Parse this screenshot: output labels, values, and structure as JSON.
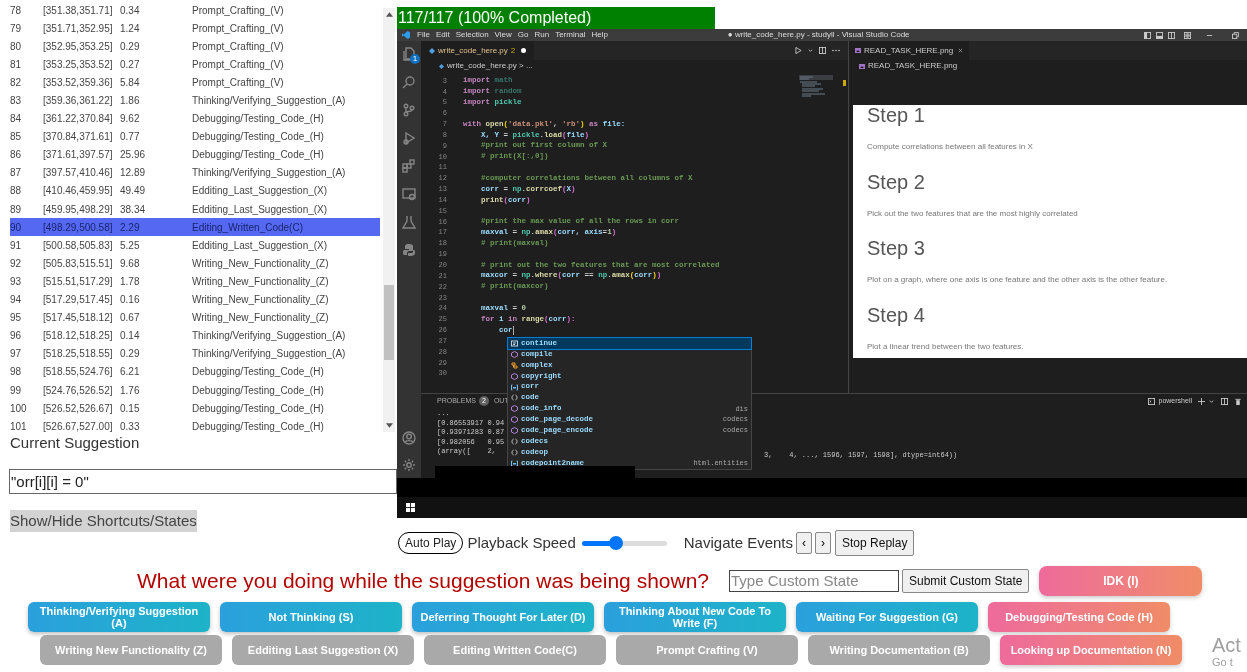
{
  "events_table": {
    "rows": [
      {
        "index": "78",
        "interval": "[351.38,351.71]",
        "duration": "0.34",
        "state": "Prompt_Crafting_(V)",
        "selected": false
      },
      {
        "index": "79",
        "interval": "[351.71,352.95]",
        "duration": "1.24",
        "state": "Prompt_Crafting_(V)",
        "selected": false
      },
      {
        "index": "80",
        "interval": "[352.95,353.25]",
        "duration": "0.29",
        "state": "Prompt_Crafting_(V)",
        "selected": false
      },
      {
        "index": "81",
        "interval": "[353.25,353.52]",
        "duration": "0.27",
        "state": "Prompt_Crafting_(V)",
        "selected": false
      },
      {
        "index": "82",
        "interval": "[353.52,359.36]",
        "duration": "5.84",
        "state": "Prompt_Crafting_(V)",
        "selected": false
      },
      {
        "index": "83",
        "interval": "[359.36,361.22]",
        "duration": "1.86",
        "state": "Thinking/Verifying_Suggestion_(A)",
        "selected": false
      },
      {
        "index": "84",
        "interval": "[361.22,370.84]",
        "duration": "9.62",
        "state": "Debugging/Testing_Code_(H)",
        "selected": false
      },
      {
        "index": "85",
        "interval": "[370.84,371.61]",
        "duration": "0.77",
        "state": "Debugging/Testing_Code_(H)",
        "selected": false
      },
      {
        "index": "86",
        "interval": "[371.61,397.57]",
        "duration": "25.96",
        "state": "Debugging/Testing_Code_(H)",
        "selected": false
      },
      {
        "index": "87",
        "interval": "[397.57,410.46]",
        "duration": "12.89",
        "state": "Thinking/Verifying_Suggestion_(A)",
        "selected": false
      },
      {
        "index": "88",
        "interval": "[410.46,459.95]",
        "duration": "49.49",
        "state": "Edditing_Last_Suggestion_(X)",
        "selected": false
      },
      {
        "index": "89",
        "interval": "[459.95,498.29]",
        "duration": "38.34",
        "state": "Edditing_Last_Suggestion_(X)",
        "selected": false
      },
      {
        "index": "90",
        "interval": "[498.29,500.58]",
        "duration": "2.29",
        "state": "Editing_Written_Code(C)",
        "selected": true
      },
      {
        "index": "91",
        "interval": "[500.58,505.83]",
        "duration": "5.25",
        "state": "Edditing_Last_Suggestion_(X)",
        "selected": false
      },
      {
        "index": "92",
        "interval": "[505.83,515.51]",
        "duration": "9.68",
        "state": "Writing_New_Functionality_(Z)",
        "selected": false
      },
      {
        "index": "93",
        "interval": "[515.51,517.29]",
        "duration": "1.78",
        "state": "Writing_New_Functionality_(Z)",
        "selected": false
      },
      {
        "index": "94",
        "interval": "[517.29,517.45]",
        "duration": "0.16",
        "state": "Writing_New_Functionality_(Z)",
        "selected": false
      },
      {
        "index": "95",
        "interval": "[517.45,518.12]",
        "duration": "0.67",
        "state": "Writing_New_Functionality_(Z)",
        "selected": false
      },
      {
        "index": "96",
        "interval": "[518.12,518.25]",
        "duration": "0.14",
        "state": "Thinking/Verifying_Suggestion_(A)",
        "selected": false
      },
      {
        "index": "97",
        "interval": "[518.25,518.55]",
        "duration": "0.29",
        "state": "Thinking/Verifying_Suggestion_(A)",
        "selected": false
      },
      {
        "index": "98",
        "interval": "[518.55,524.76]",
        "duration": "6.21",
        "state": "Debugging/Testing_Code_(H)",
        "selected": false
      },
      {
        "index": "99",
        "interval": "[524.76,526.52]",
        "duration": "1.76",
        "state": "Debugging/Testing_Code_(H)",
        "selected": false
      },
      {
        "index": "100",
        "interval": "[526.52,526.67]",
        "duration": "0.15",
        "state": "Debugging/Testing_Code_(H)",
        "selected": false
      },
      {
        "index": "101",
        "interval": "[526.67,527.00]",
        "duration": "0.33",
        "state": "Debugging/Testing_Code_(H)",
        "selected": false
      }
    ]
  },
  "current_suggestion": {
    "label": "Current Suggestion",
    "value": "\"orr[i][i] = 0\""
  },
  "toggle_button": "Show/Hide Shortcuts/States",
  "progress": {
    "label": "117/117 (100% Completed)"
  },
  "vscode": {
    "menu": [
      "File",
      "Edit",
      "Selection",
      "View",
      "Go",
      "Run",
      "Terminal",
      "Help"
    ],
    "window_title": "● write_code_here.py - studyll - Visual Studio Code",
    "explorer_badge": "1",
    "editor_tab": {
      "name": "write_code_here.py",
      "count": "2",
      "modified": true
    },
    "breadcrumb": "write_code_here.py > ...",
    "code_lines": [
      {
        "number": "3",
        "tokens": [
          {
            "text": "import",
            "kind": "kw"
          },
          {
            "text": " math",
            "kind": "dim"
          }
        ]
      },
      {
        "number": "4",
        "tokens": [
          {
            "text": "import",
            "kind": "kw"
          },
          {
            "text": " random",
            "kind": "dim"
          }
        ]
      },
      {
        "number": "5",
        "tokens": [
          {
            "text": "import",
            "kind": "kw"
          },
          {
            "text": " pickle",
            "kind": "mod"
          }
        ]
      },
      {
        "number": "6"
      },
      {
        "number": "7",
        "tokens": [
          {
            "text": "with",
            "kind": "kw"
          },
          {
            "text": " open",
            "kind": "fn"
          },
          {
            "text": "(",
            "kind": "br"
          },
          {
            "text": "'data.pkl'",
            "kind": "str"
          },
          {
            "text": ", ",
            "kind": "pl"
          },
          {
            "text": "'rb'",
            "kind": "str"
          },
          {
            "text": ")",
            "kind": "br"
          },
          {
            "text": " as",
            "kind": "kw"
          },
          {
            "text": " file:",
            "kind": "var"
          }
        ]
      },
      {
        "number": "8",
        "tokens": [
          {
            "text": "    X, Y",
            "kind": "var"
          },
          {
            "text": " = ",
            "kind": "pl"
          },
          {
            "text": "pickle",
            "kind": "mod"
          },
          {
            "text": ".",
            "kind": "pl"
          },
          {
            "text": "load",
            "kind": "fn"
          },
          {
            "text": "(",
            "kind": "br2"
          },
          {
            "text": "file",
            "kind": "var"
          },
          {
            "text": ")",
            "kind": "br2"
          }
        ]
      },
      {
        "number": "9",
        "tokens": [
          {
            "text": "    #print out first column of X",
            "kind": "cmt"
          }
        ]
      },
      {
        "number": "10",
        "tokens": [
          {
            "text": "    # print(X[:,0])",
            "kind": "cmt"
          }
        ]
      },
      {
        "number": "11"
      },
      {
        "number": "12",
        "tokens": [
          {
            "text": "    #computer correlations between all columns of X",
            "kind": "cmt"
          }
        ]
      },
      {
        "number": "13",
        "tokens": [
          {
            "text": "    corr",
            "kind": "var"
          },
          {
            "text": " = ",
            "kind": "pl"
          },
          {
            "text": "np",
            "kind": "mod"
          },
          {
            "text": ".",
            "kind": "pl"
          },
          {
            "text": "corrcoef",
            "kind": "fn"
          },
          {
            "text": "(",
            "kind": "br2"
          },
          {
            "text": "X",
            "kind": "var"
          },
          {
            "text": ")",
            "kind": "br2"
          }
        ]
      },
      {
        "number": "14",
        "tokens": [
          {
            "text": "    print",
            "kind": "fn"
          },
          {
            "text": "(",
            "kind": "br2"
          },
          {
            "text": "corr",
            "kind": "var"
          },
          {
            "text": ")",
            "kind": "br2"
          }
        ]
      },
      {
        "number": "15"
      },
      {
        "number": "16",
        "tokens": [
          {
            "text": "    #print the max value of all the rows in corr",
            "kind": "cmt"
          }
        ]
      },
      {
        "number": "17",
        "tokens": [
          {
            "text": "    maxval",
            "kind": "var"
          },
          {
            "text": " = ",
            "kind": "pl"
          },
          {
            "text": "np",
            "kind": "mod"
          },
          {
            "text": ".",
            "kind": "pl"
          },
          {
            "text": "amax",
            "kind": "fn"
          },
          {
            "text": "(",
            "kind": "br2"
          },
          {
            "text": "corr, axis",
            "kind": "var"
          },
          {
            "text": "=",
            "kind": "pl"
          },
          {
            "text": "1",
            "kind": "num"
          },
          {
            "text": ")",
            "kind": "br2"
          }
        ]
      },
      {
        "number": "18",
        "tokens": [
          {
            "text": "    # print(maxval)",
            "kind": "cmt"
          }
        ]
      },
      {
        "number": "19"
      },
      {
        "number": "20",
        "tokens": [
          {
            "text": "    # print out the two features that are most correlated",
            "kind": "cmt"
          }
        ]
      },
      {
        "number": "21",
        "tokens": [
          {
            "text": "    maxcor",
            "kind": "var"
          },
          {
            "text": " = ",
            "kind": "pl"
          },
          {
            "text": "np",
            "kind": "mod"
          },
          {
            "text": ".",
            "kind": "pl"
          },
          {
            "text": "where",
            "kind": "fn"
          },
          {
            "text": "(",
            "kind": "br2"
          },
          {
            "text": "corr",
            "kind": "var"
          },
          {
            "text": " == ",
            "kind": "pl"
          },
          {
            "text": "np",
            "kind": "mod"
          },
          {
            "text": ".",
            "kind": "pl"
          },
          {
            "text": "amax",
            "kind": "fn"
          },
          {
            "text": "(",
            "kind": "br"
          },
          {
            "text": "corr",
            "kind": "var"
          },
          {
            "text": ")",
            "kind": "br"
          },
          {
            "text": ")",
            "kind": "br2"
          }
        ]
      },
      {
        "number": "22",
        "tokens": [
          {
            "text": "    # print(maxcor)",
            "kind": "cmt"
          }
        ]
      },
      {
        "number": "23"
      },
      {
        "number": "24",
        "tokens": [
          {
            "text": "    maxval",
            "kind": "var"
          },
          {
            "text": " = ",
            "kind": "pl"
          },
          {
            "text": "0",
            "kind": "num"
          }
        ]
      },
      {
        "number": "25",
        "tokens": [
          {
            "text": "    for",
            "kind": "kw"
          },
          {
            "text": " i",
            "kind": "var"
          },
          {
            "text": " in",
            "kind": "kw"
          },
          {
            "text": " range",
            "kind": "fn"
          },
          {
            "text": "(",
            "kind": "br2"
          },
          {
            "text": "corr",
            "kind": "var"
          },
          {
            "text": "):",
            "kind": "br2"
          }
        ]
      },
      {
        "number": "26",
        "tokens": [
          {
            "text": "        cor",
            "kind": "var"
          }
        ],
        "cursor": true
      },
      {
        "number": "27"
      },
      {
        "number": "28"
      },
      {
        "number": "29"
      },
      {
        "number": "30"
      }
    ],
    "suggestions": [
      {
        "label": "continue",
        "kind": "keyword",
        "selected": true
      },
      {
        "label": "compile",
        "kind": "method",
        "selected": false
      },
      {
        "label": "complex",
        "kind": "class",
        "selected": false
      },
      {
        "label": "copyright",
        "kind": "method",
        "selected": false
      },
      {
        "label": "corr",
        "kind": "variable",
        "selected": false
      },
      {
        "label": "code",
        "kind": "module",
        "selected": false
      },
      {
        "label": "code_info",
        "kind": "method",
        "detail": "dis",
        "selected": false
      },
      {
        "label": "code_page_decode",
        "kind": "method",
        "detail": "codecs",
        "selected": false
      },
      {
        "label": "code_page_encode",
        "kind": "method",
        "detail": "codecs",
        "selected": false
      },
      {
        "label": "codecs",
        "kind": "module",
        "selected": false
      },
      {
        "label": "codeop",
        "kind": "module",
        "selected": false
      },
      {
        "label": "codepoint2name",
        "kind": "variable",
        "detail": "html.entities",
        "selected": false
      }
    ],
    "panel": {
      "tabs": [
        {
          "label": "PROBLEMS",
          "count": "2"
        },
        {
          "label": "OUT"
        }
      ],
      "terminal_lines": [
        "...",
        "[0.86553917 0.94",
        "[0.93971283 0.87",
        "[0.982056   0.95",
        "(array([    2,"
      ],
      "terminal_tail": "3,    4, ..., 1596, 1597, 1598], dtype=int64))",
      "shell": "powershell"
    },
    "image_tab": "READ_TASK_HERE.png",
    "image_breadcrumb": "READ_TASK_HERE.png",
    "steps": [
      {
        "title": "Step 1",
        "text": "Compute correlations between all features in X"
      },
      {
        "title": "Step 2",
        "text": "Pick out the two features that are the most highly correlated"
      },
      {
        "title": "Step 3",
        "text": "Plot on a graph, where one axis is one feature and the other axis is the other feature."
      },
      {
        "title": "Step 4",
        "text": "Plot a linear trend between the two features."
      }
    ]
  },
  "playback": {
    "auto_play": "Auto Play",
    "speed": {
      "label": "Playback Speed",
      "level": 0.4
    },
    "navigate_label": "Navigate Events",
    "previous": "‹",
    "next": "›",
    "stop": "Stop Replay"
  },
  "question": {
    "prompt": "What were you doing while the suggestion was being shown?",
    "custom_state": {
      "placeholder": "Type Custom State"
    },
    "submit": "Submit Custom State",
    "idk": {
      "label": "IDK (I)",
      "kind": "accent"
    }
  },
  "state_button_rows": [
    {
      "buttons": [
        {
          "label": "Thinking/Verifying Suggestion (A)",
          "kind": "primary"
        },
        {
          "label": "Not Thinking (S)",
          "kind": "primary"
        },
        {
          "label": "Deferring Thought For Later (D)",
          "kind": "primary"
        },
        {
          "label": "Thinking About New Code To Write (F)",
          "kind": "primary"
        },
        {
          "label": "Waiting For Suggestion (G)",
          "kind": "primary"
        },
        {
          "label": "Debugging/Testing Code (H)",
          "kind": "accent"
        }
      ]
    },
    {
      "buttons": [
        {
          "label": "Writing New Functionality (Z)",
          "kind": "muted"
        },
        {
          "label": "Edditing Last Suggestion (X)",
          "kind": "muted"
        },
        {
          "label": "Editing Written Code(C)",
          "kind": "muted"
        },
        {
          "label": "Prompt Crafting (V)",
          "kind": "muted"
        },
        {
          "label": "Writing Documentation (B)",
          "kind": "muted"
        },
        {
          "label": "Looking up Documentation (N)",
          "kind": "accent"
        }
      ]
    }
  ],
  "activation_notice": {
    "line_1": "Act",
    "line_2": "Go t"
  }
}
